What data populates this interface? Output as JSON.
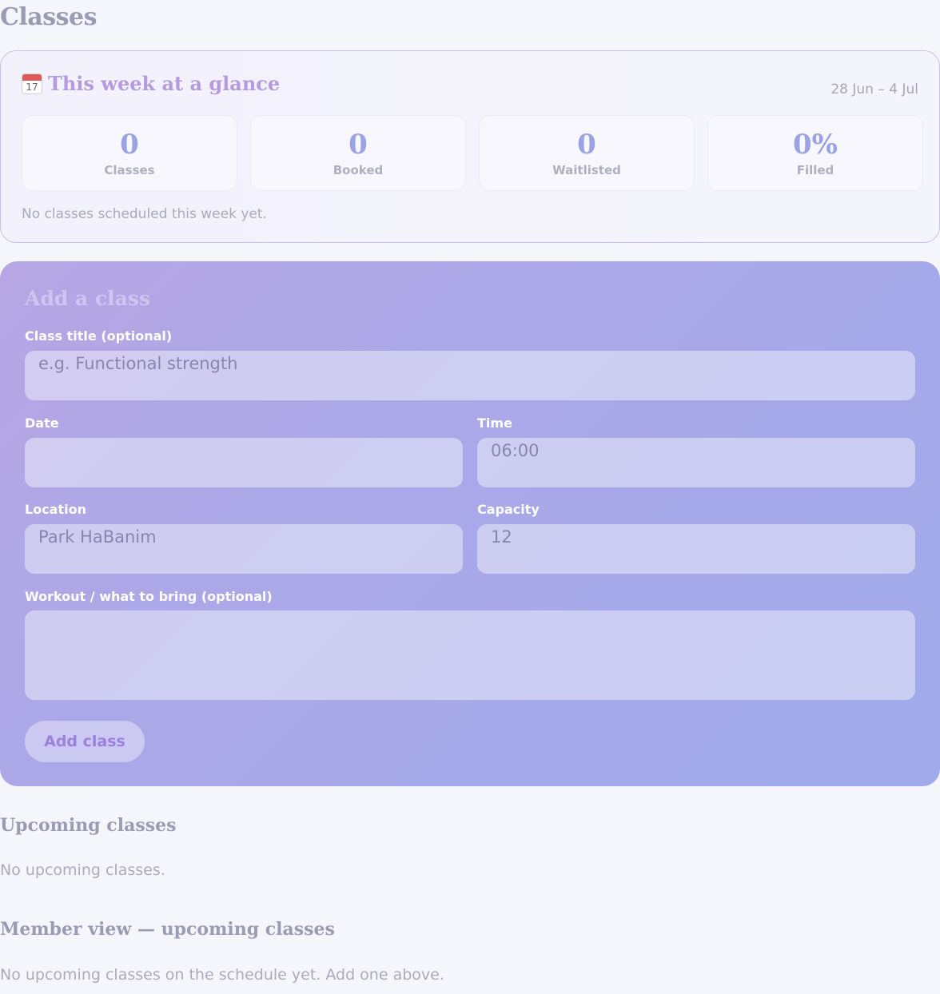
{
  "page": {
    "title": "Classes"
  },
  "week": {
    "icon": "calendar-icon",
    "icon_day": "17",
    "title": "This week at a glance",
    "range": "28 Jun – 4 Jul",
    "stats": [
      {
        "value": "0",
        "label": "Classes"
      },
      {
        "value": "0",
        "label": "Booked"
      },
      {
        "value": "0",
        "label": "Waitlisted"
      },
      {
        "value": "0%",
        "label": "Filled"
      }
    ],
    "empty_text": "No classes scheduled this week yet."
  },
  "add_class": {
    "title": "Add a class",
    "fields": {
      "title": {
        "label": "Class title (optional)",
        "value": "",
        "placeholder": "e.g. Functional strength"
      },
      "date": {
        "label": "Date",
        "value": ""
      },
      "time": {
        "label": "Time",
        "value": "06:00"
      },
      "location": {
        "label": "Location",
        "value": "Park HaBanim"
      },
      "capacity": {
        "label": "Capacity",
        "value": "12"
      },
      "workout": {
        "label": "Workout / what to bring (optional)",
        "value": ""
      }
    },
    "submit_label": "Add class"
  },
  "upcoming": {
    "title": "Upcoming classes",
    "empty_text": "No upcoming classes."
  },
  "member_view": {
    "title": "Member view — upcoming classes",
    "empty_text": "No upcoming classes on the schedule yet. Add one above."
  },
  "colors": {
    "accent": "#b59ae0",
    "stat_value": "#99a3e6",
    "card_gradient_start": "#b6a6e4",
    "card_gradient_end": "#9faaea"
  }
}
